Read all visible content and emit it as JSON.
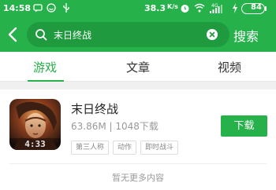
{
  "status_bar": {
    "time": "14:58",
    "speed": "38.3",
    "speed_unit": "K/s",
    "signal_label": "4G",
    "battery": "84"
  },
  "header": {
    "query": "末日终战",
    "search_label": "搜索"
  },
  "tabs": [
    {
      "label": "游戏",
      "active": true
    },
    {
      "label": "文章",
      "active": false
    },
    {
      "label": "视频",
      "active": false
    }
  ],
  "result": {
    "name": "末日终战",
    "size": "63.86M",
    "downloads": "1048下载",
    "meta": "63.86M | 1048下载",
    "tags": [
      "第三人称",
      "动作",
      "即时战斗"
    ],
    "download_label": "下载",
    "icon_label": "4:33"
  },
  "footer": {
    "no_more": "暂无更多内容"
  },
  "colors": {
    "brand": "#27b14a",
    "brand_dark": "#1f9a3f"
  }
}
